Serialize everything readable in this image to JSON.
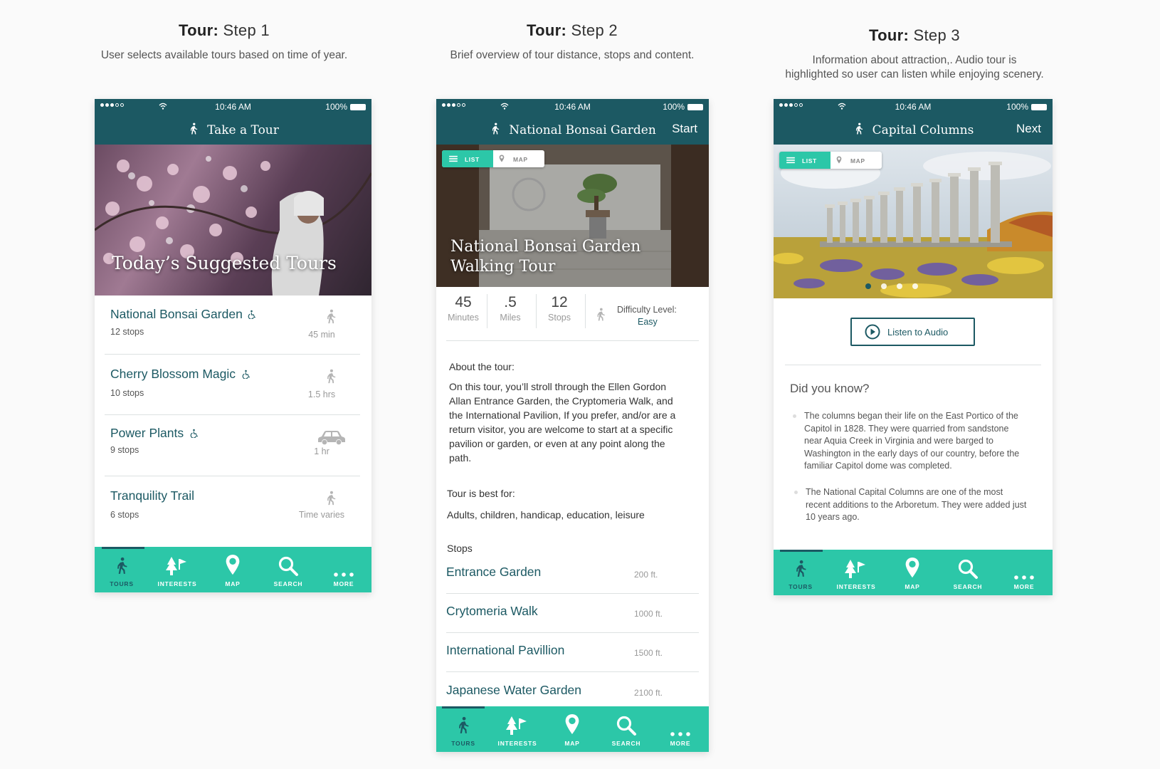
{
  "colors": {
    "teal_dark": "#1c5963",
    "teal_bright": "#2cc7a8",
    "divider": "#dde1e2"
  },
  "steps": [
    {
      "title_bold": "Tour:",
      "title_light": "Step 1",
      "desc": "User selects available tours based on time of year."
    },
    {
      "title_bold": "Tour:",
      "title_light": "Step 2",
      "desc": "Brief overview of tour distance, stops and content."
    },
    {
      "title_bold": "Tour:",
      "title_light": "Step 3",
      "desc_line1": "Information about attraction,. Audio tour is",
      "desc_line2": "highlighted so user can listen while enjoying scenery."
    }
  ],
  "status": {
    "time": "10:46 AM",
    "battery": "100%"
  },
  "phone1": {
    "nav_title": "Take a Tour",
    "hero_title": "Today’s Suggested Tours",
    "tours": [
      {
        "name": "National Bonsai Garden",
        "stops": "12 stops",
        "duration": "45 min",
        "mode_icon": "walking-icon"
      },
      {
        "name": "Cherry Blossom Magic",
        "stops": "10 stops",
        "duration": "1.5 hrs",
        "mode_icon": "walking-icon"
      },
      {
        "name": "Power Plants",
        "stops": "9 stops",
        "duration": "1 hr",
        "mode_icon": "car-icon"
      },
      {
        "name": "Tranquility Trail",
        "stops": "6 stops",
        "duration": "Time varies",
        "mode_icon": "walking-icon"
      }
    ]
  },
  "phone2": {
    "nav_title": "National Bonsai Garden",
    "nav_action": "Start",
    "seg_list": "LIST",
    "seg_map": "MAP",
    "hero_line1": "National Bonsai Garden",
    "hero_line2": "Walking Tour",
    "stats": [
      {
        "value": "45",
        "unit": "Minutes"
      },
      {
        "value": ".5",
        "unit": "Miles"
      },
      {
        "value": "12",
        "unit": "Stops"
      }
    ],
    "difficulty_label": "Difficulty Level:",
    "difficulty_value": "Easy",
    "about_heading": "About the tour:",
    "about_lines": [
      "On this tour, you’ll stroll through the Ellen Gordon",
      "Allan Entrance Garden, the Cryptomeria Walk, and",
      "the International Pavilion, If you prefer, and/or are a",
      "return visitor, you are welcome to start at a specific",
      "pavilion or garden, or even at any point along the",
      "path."
    ],
    "best_heading": "Tour is best for:",
    "best_text": "Adults, children, handicap, education, leisure",
    "stops_heading": "Stops",
    "stops": [
      {
        "name": "Entrance Garden",
        "dist": "200 ft."
      },
      {
        "name": "Crytomeria Walk",
        "dist": "1000 ft."
      },
      {
        "name": "International Pavillion",
        "dist": "1500 ft."
      },
      {
        "name": "Japanese Water Garden",
        "dist": "2100 ft."
      }
    ]
  },
  "phone3": {
    "nav_title": "Capital Columns",
    "nav_action": "Next",
    "seg_list": "LIST",
    "seg_map": "MAP",
    "carousel_pages": 4,
    "carousel_active": 1,
    "audio_button": "Listen to Audio",
    "dyk_heading": "Did you know?",
    "bullet1_lines": [
      "The columns began their life on the East Portico of the",
      "Capitol in 1828.  They were quarried from sandstone",
      "near Aquia Creek in Virginia and were barged to",
      "Washington in the early days of our country, before the",
      "familiar Capitol dome was completed."
    ],
    "bullet2_lines": [
      "The National Capital Columns are one of the most",
      "recent additions to the Arboretum. They were added just",
      "10 years ago."
    ]
  },
  "tabs": [
    {
      "label": "TOURS",
      "icon": "walking-icon"
    },
    {
      "label": "INTERESTS",
      "icon": "tree-flag-icon"
    },
    {
      "label": "MAP",
      "icon": "map-pin-icon"
    },
    {
      "label": "SEARCH",
      "icon": "search-icon"
    },
    {
      "label": "MORE",
      "icon": "more-icon"
    }
  ]
}
